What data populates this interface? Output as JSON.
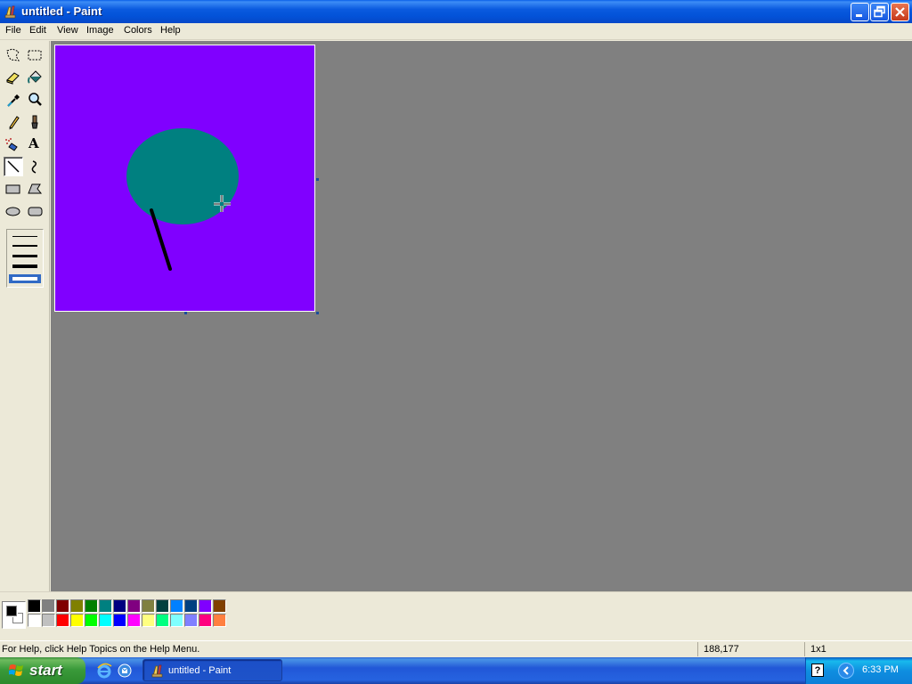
{
  "window": {
    "title": "untitled - Paint"
  },
  "menu": [
    {
      "label": "File"
    },
    {
      "label": "Edit"
    },
    {
      "label": "View"
    },
    {
      "label": "Image"
    },
    {
      "label": "Colors"
    },
    {
      "label": "Help"
    }
  ],
  "tools": [
    {
      "name": "free-form-select-icon"
    },
    {
      "name": "rect-select-icon"
    },
    {
      "name": "eraser-icon"
    },
    {
      "name": "fill-bucket-icon"
    },
    {
      "name": "pick-color-icon"
    },
    {
      "name": "magnifier-icon"
    },
    {
      "name": "pencil-icon"
    },
    {
      "name": "brush-icon"
    },
    {
      "name": "airbrush-icon"
    },
    {
      "name": "text-icon",
      "glyph": "A"
    },
    {
      "name": "line-icon",
      "active": true
    },
    {
      "name": "curve-icon"
    },
    {
      "name": "rectangle-icon"
    },
    {
      "name": "polygon-icon"
    },
    {
      "name": "ellipse-icon"
    },
    {
      "name": "rounded-rectangle-icon"
    }
  ],
  "line_widths": [
    1,
    2,
    3,
    4,
    5
  ],
  "line_width_selected": 5,
  "canvas": {
    "background": "#8000ff",
    "ellipse_color": "#008080",
    "stroke_color": "#000000"
  },
  "colors": {
    "foreground": "#000000",
    "background": "#ffffff",
    "palette_top": [
      "#000000",
      "#808080",
      "#800000",
      "#808000",
      "#008000",
      "#008080",
      "#000080",
      "#800080",
      "#808040",
      "#004040",
      "#0080ff",
      "#004080",
      "#8000ff",
      "#804000"
    ],
    "palette_bottom": [
      "#ffffff",
      "#c0c0c0",
      "#ff0000",
      "#ffff00",
      "#00ff00",
      "#00ffff",
      "#0000ff",
      "#ff00ff",
      "#ffff80",
      "#00ff80",
      "#80ffff",
      "#8080ff",
      "#ff0080",
      "#ff8040"
    ]
  },
  "status": {
    "help": "For Help, click Help Topics on the Help Menu.",
    "coords": "188,177",
    "size": "1x1"
  },
  "taskbar": {
    "start_label": "start",
    "task_label": "untitled - Paint",
    "clock": "6:33 PM",
    "help_glyph": "?"
  }
}
